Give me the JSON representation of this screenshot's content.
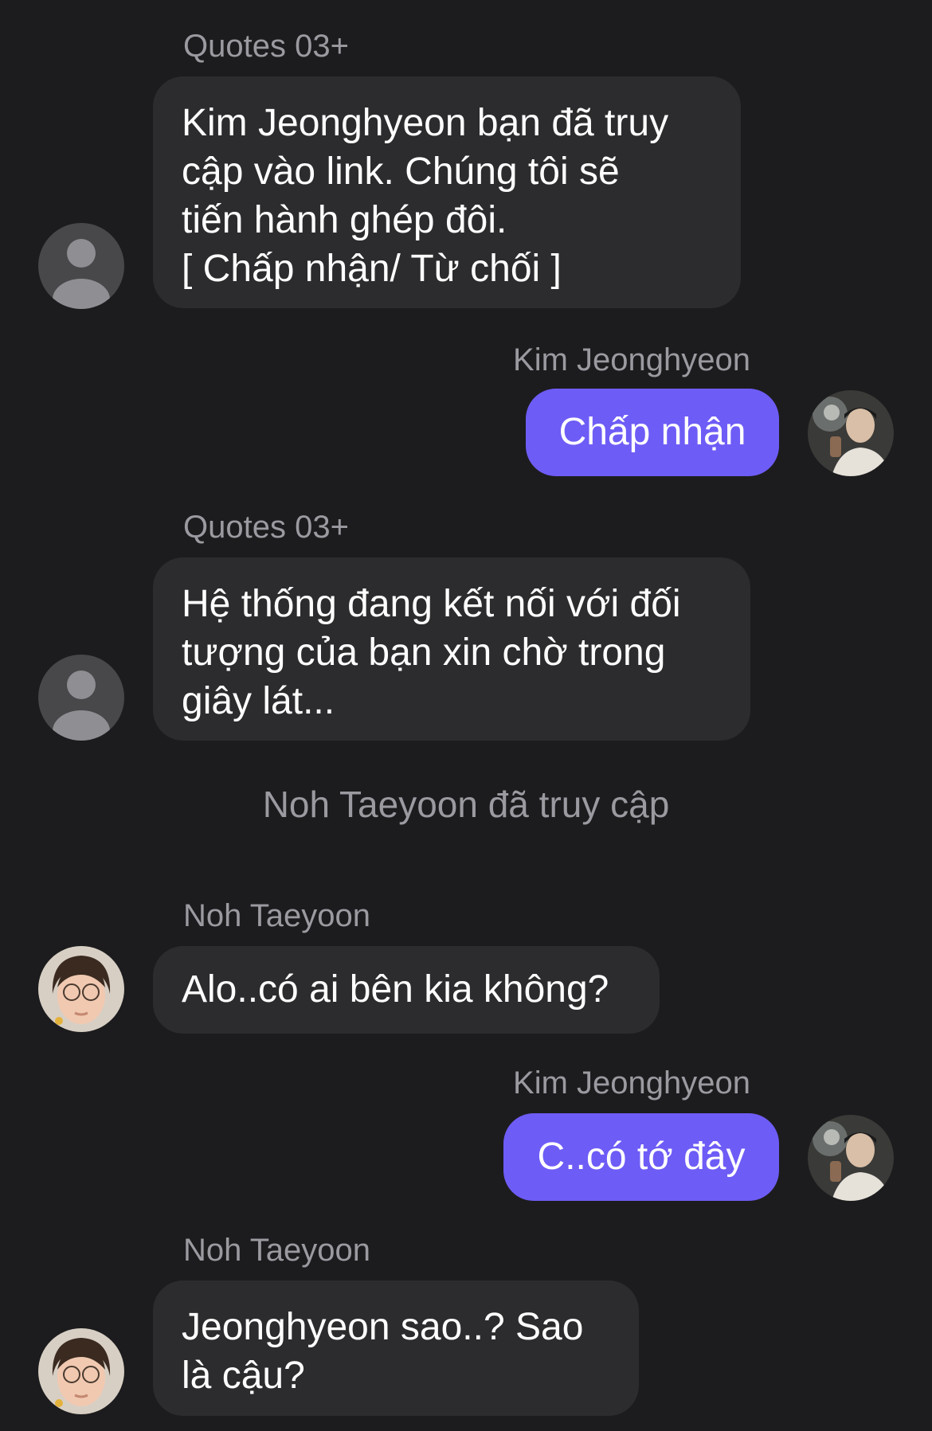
{
  "conversation": {
    "messages": [
      {
        "sender": "Quotes 03+",
        "direction": "incoming",
        "avatar": "person-placeholder-icon",
        "lines": [
          "Kim Jeonghyeon bạn đã truy",
          "cập vào link. Chúng tôi sẽ",
          "tiến hành ghép đôi.",
          "[ Chấp nhận/ Từ chối ]"
        ]
      },
      {
        "sender": "Kim Jeonghyeon",
        "direction": "outgoing",
        "avatar": "photo-avatar-kim",
        "text": "Chấp nhận"
      },
      {
        "sender": "Quotes 03+",
        "direction": "incoming",
        "avatar": "person-placeholder-icon",
        "lines": [
          "Hệ thống đang kết nối với đối",
          "tượng của bạn xin chờ trong",
          "giây lát..."
        ]
      },
      {
        "system": "Noh Taeyoon đã truy cập"
      },
      {
        "sender": "Noh Taeyoon",
        "direction": "incoming",
        "avatar": "photo-avatar-noh",
        "text": "Alo..có ai bên kia không?"
      },
      {
        "sender": "Kim Jeonghyeon",
        "direction": "outgoing",
        "avatar": "photo-avatar-kim",
        "text": "C..có tớ đây"
      },
      {
        "sender": "Noh Taeyoon",
        "direction": "incoming",
        "avatar": "photo-avatar-noh",
        "lines": [
          "Jeonghyeon sao..? Sao",
          "là cậu?"
        ]
      }
    ]
  },
  "colors": {
    "background": "#1c1c1e",
    "incoming_bubble": "#2c2c2e",
    "outgoing_bubble": "#6e5cf6",
    "sender_text": "#9a9aa0"
  }
}
